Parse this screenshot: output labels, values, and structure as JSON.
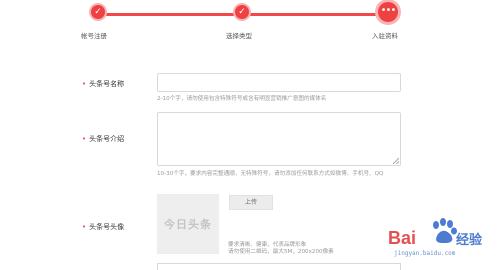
{
  "stepper": {
    "steps": [
      {
        "label": "帐号注册",
        "icon": "check-icon",
        "glyph": "✓"
      },
      {
        "label": "选择类型",
        "icon": "check-icon",
        "glyph": "✓"
      },
      {
        "label": "入驻资料",
        "icon": "more-dots-icon",
        "glyph": "•••"
      }
    ],
    "accent_color": "#f04142"
  },
  "form": {
    "name": {
      "required_mark": "•",
      "label": "头条号名称",
      "value": "",
      "hint": "2-10个字，请勿使用包含特殊符号或含有明显营销推广意图的媒体名"
    },
    "intro": {
      "required_mark": "•",
      "label": "头条号介绍",
      "value": "",
      "hint": "10-30个字，要求内容完整通顺，无特殊符号，请勿添加任何联系方式如微博、手机号、QQ"
    },
    "avatar": {
      "required_mark": "•",
      "label": "头条号头像",
      "placeholder_text": "今日头条",
      "upload_label": "上传",
      "hint_line1": "要求清晰、健康，代表品牌形象",
      "hint_line2": "请勿使用二维码，最大5M，200x200像素"
    }
  },
  "watermark": {
    "brand": "Baidu经验",
    "url": "jingyan.baidu.com"
  }
}
